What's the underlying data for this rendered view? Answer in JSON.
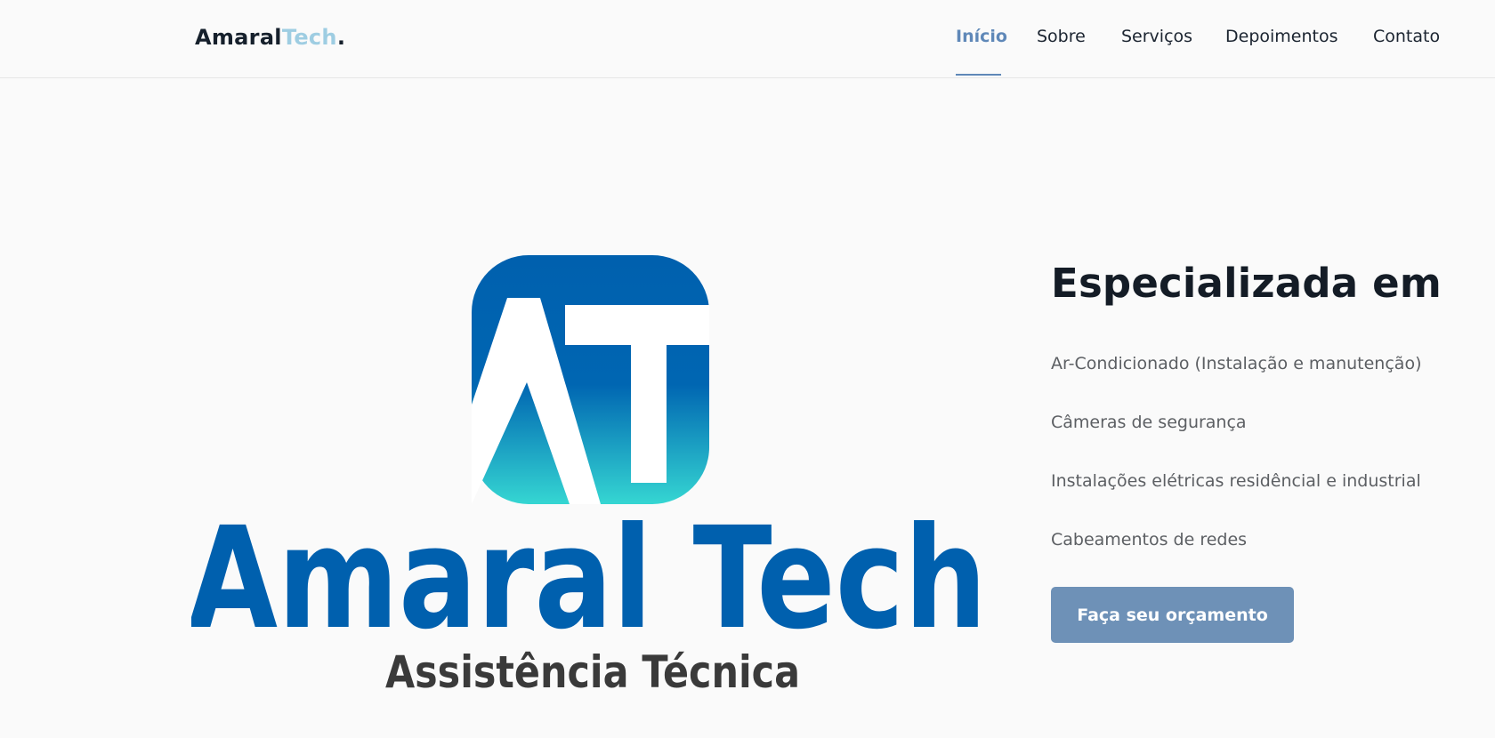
{
  "header": {
    "brand": {
      "part1": "Amaral",
      "part2": "Tech",
      "part3": "."
    },
    "nav": [
      {
        "label": "Início",
        "active": true
      },
      {
        "label": "Sobre",
        "active": false
      },
      {
        "label": "Serviços",
        "active": false
      },
      {
        "label": "Depoimentos",
        "active": false
      },
      {
        "label": "Contato",
        "active": false
      }
    ]
  },
  "hero": {
    "logo": {
      "name": "Amaral Tech",
      "tagline": "Assistência Técnica",
      "icon": "amaral-tech-logo-icon"
    },
    "heading": "Especializada em",
    "services": [
      "Ar-Condicionado (Instalação e manutenção)",
      "Câmeras de segurança",
      "Instalações elétricas residêncial e industrial",
      "Cabeamentos de redes"
    ],
    "cta_label": "Faça seu orçamento"
  },
  "colors": {
    "accent": "#5f88b8",
    "button": "#6e91b7",
    "logo_blue": "#0060ae",
    "logo_teal": "#2fd3d1"
  }
}
